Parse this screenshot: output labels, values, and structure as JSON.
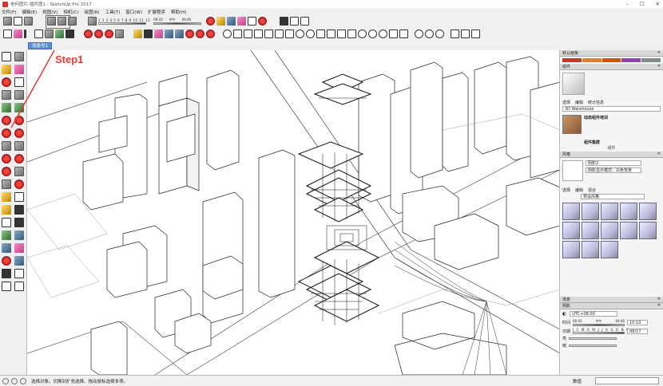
{
  "window": {
    "title": "老何图片-插件图1 - SketchUp Pro 2017",
    "minimize": "–",
    "maximize": "☐",
    "close": "✕"
  },
  "menu": [
    "文件(F)",
    "编辑(E)",
    "视图(V)",
    "相机(C)",
    "绘图(R)",
    "工具(T)",
    "窗口(W)",
    "扩展程序",
    "帮助(H)"
  ],
  "scene_tab": "场景号1",
  "annotation": {
    "label": "Step1",
    "color": "#e53935"
  },
  "shadow_slider": {
    "months": "1 2 3 4 5 6 7 8 9 10 11 12",
    "time_start": "06:43",
    "time_mid": "中午",
    "time_end": "04:46"
  },
  "right_panel": {
    "default_tray": "默认面板",
    "components": {
      "header": "组件",
      "tabs": [
        "选择",
        "编辑",
        "统计信息"
      ],
      "search_placeholder": "3D Warehouse",
      "item_title": "动态组件培训",
      "item_sub": "组件集群",
      "footer": "组件"
    },
    "styles": {
      "header": "风格",
      "name": "阴影2",
      "desc": "阴影显示模式：白色背景",
      "tabs": [
        "选择",
        "编辑",
        "混合"
      ],
      "dropdown": "预设风格"
    },
    "scenes_header": "场景",
    "shadows": {
      "header": "阴影",
      "timezone": "UTC+08:00",
      "time_label": "时间",
      "time_start": "06:43",
      "time_mid": "中午",
      "time_end": "04:46",
      "time_value": "10:10",
      "date_label": "日期",
      "date_months": "J F M A M J J A S O N D",
      "date_value": "08/17",
      "light_label": "亮",
      "dark_label": "暗"
    }
  },
  "status": {
    "hint": "选择对象。切换到扩充选择。拖动鼠标选择多项。",
    "measure_label": "数值"
  },
  "colors": {
    "accent_red": "#e53935",
    "scene_tab": "#5b8fd6",
    "swatch_colors": [
      "#c0392b",
      "#e67e22",
      "#d35400",
      "#8e44ad",
      "#7f8c8d"
    ]
  }
}
